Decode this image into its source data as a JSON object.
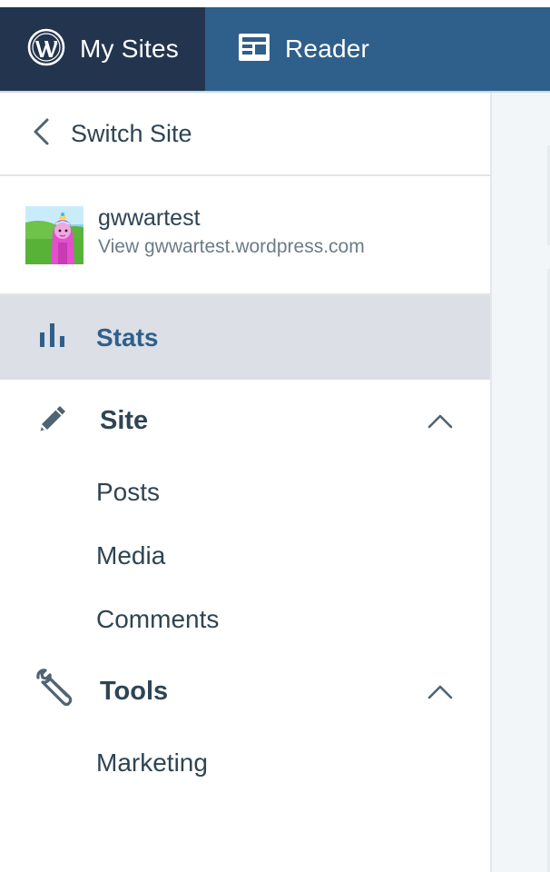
{
  "topbar": {
    "my_sites": {
      "label": "My Sites",
      "icon": "wordpress-logo-icon"
    },
    "reader": {
      "label": "Reader",
      "icon": "reader-icon"
    }
  },
  "sidebar": {
    "switch_site": {
      "label": "Switch Site",
      "icon": "chevron-left-icon"
    },
    "site": {
      "name": "gwwartest",
      "url_text": "View gwwartest.wordpress.com"
    },
    "stats": {
      "label": "Stats",
      "icon": "stats-bar-chart-icon",
      "selected": true
    },
    "site_section": {
      "label": "Site",
      "icon": "pencil-icon",
      "expanded": true,
      "items": [
        {
          "label": "Posts"
        },
        {
          "label": "Media"
        },
        {
          "label": "Comments"
        }
      ]
    },
    "tools_section": {
      "label": "Tools",
      "icon": "wrench-icon",
      "expanded": true,
      "items": [
        {
          "label": "Marketing"
        }
      ]
    }
  },
  "colors": {
    "my_sites_tab_bg": "#23354e",
    "reader_tab_bg": "#2f5f8b",
    "selected_bg": "#dcdfe6",
    "selected_text": "#2f5f8b",
    "text_primary": "#2e4453",
    "text_secondary": "#6b7c87"
  }
}
